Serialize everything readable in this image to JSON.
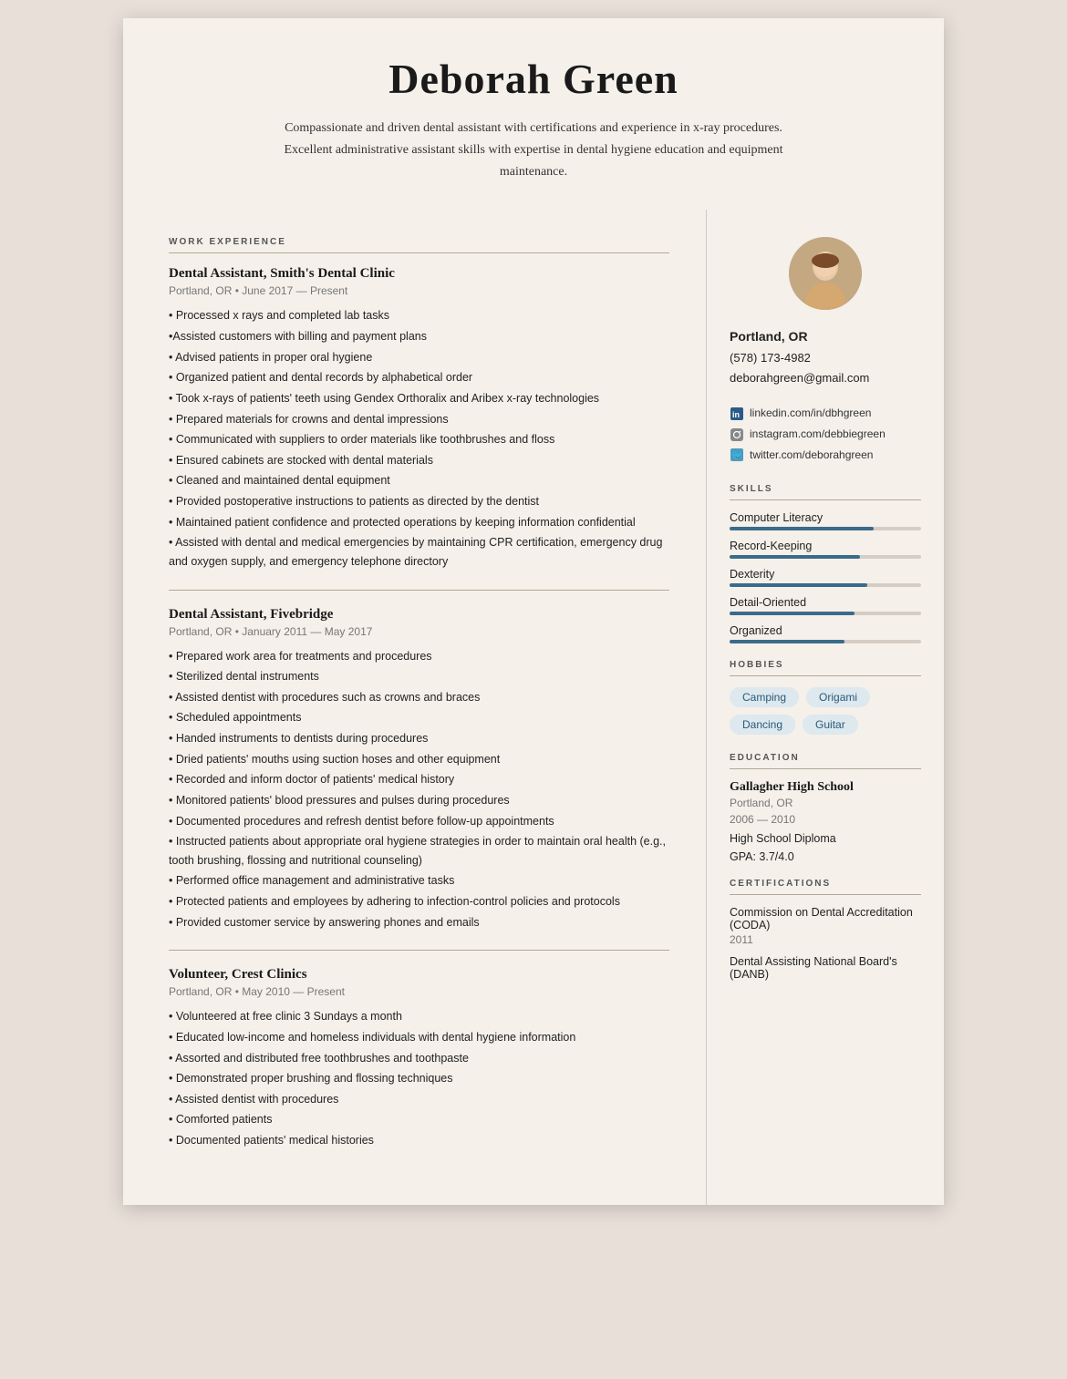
{
  "header": {
    "name": "Deborah Green",
    "summary": "Compassionate and driven dental assistant with certifications and experience in x-ray procedures. Excellent administrative assistant skills with expertise in dental hygiene education and equipment maintenance."
  },
  "sidebar": {
    "location": "Portland, OR",
    "phone": "(578) 173-4982",
    "email": "deborahgreen@gmail.com",
    "social": [
      {
        "icon": "linkedin",
        "text": "linkedin.com/in/dbhgreen"
      },
      {
        "icon": "instagram",
        "text": "instagram.com/debbiegreen"
      },
      {
        "icon": "twitter",
        "text": "twitter.com/deborahgreen"
      }
    ],
    "skills_label": "SKILLS",
    "skills": [
      {
        "name": "Computer Literacy",
        "pct": 75
      },
      {
        "name": "Record-Keeping",
        "pct": 68
      },
      {
        "name": "Dexterity",
        "pct": 72
      },
      {
        "name": "Detail-Oriented",
        "pct": 65
      },
      {
        "name": "Organized",
        "pct": 60
      }
    ],
    "hobbies_label": "HOBBIES",
    "hobbies": [
      "Camping",
      "Origami",
      "Dancing",
      "Guitar"
    ],
    "education_label": "EDUCATION",
    "education": [
      {
        "school": "Gallagher High School",
        "location": "Portland, OR",
        "years": "2006 — 2010",
        "degree": "High School Diploma",
        "gpa": "GPA: 3.7/4.0"
      }
    ],
    "certifications_label": "CERTIFICATIONS",
    "certifications": [
      {
        "name": "Commission on Dental Accreditation (CODA)",
        "year": "2011"
      },
      {
        "name": "Dental Assisting National Board's (DANB)",
        "year": ""
      }
    ]
  },
  "main": {
    "work_experience_label": "WORK EXPERIENCE",
    "jobs": [
      {
        "title": "Dental Assistant, Smith's Dental Clinic",
        "meta": "Portland, OR • June 2017 — Present",
        "bullets": [
          "• Processed x rays and completed lab tasks",
          "•Assisted customers with billing and payment plans",
          "• Advised patients in proper oral hygiene",
          "• Organized patient and dental records by alphabetical order",
          "• Took x-rays of patients' teeth using Gendex Orthoralix and Aribex x-ray technologies",
          "• Prepared materials for crowns and dental impressions",
          "• Communicated with suppliers to order materials like toothbrushes and floss",
          "• Ensured cabinets are stocked with dental materials",
          "• Cleaned and maintained dental equipment",
          "• Provided postoperative instructions to patients as directed by the dentist",
          "• Maintained patient confidence and protected operations by keeping information confidential",
          "• Assisted with dental and medical emergencies by maintaining CPR certification, emergency drug and oxygen supply, and emergency telephone directory"
        ]
      },
      {
        "title": "Dental Assistant, Fivebridge",
        "meta": "Portland, OR • January 2011 — May 2017",
        "bullets": [
          "• Prepared work area for treatments and procedures",
          "• Sterilized dental instruments",
          "• Assisted dentist with procedures such as crowns and braces",
          "• Scheduled appointments",
          "• Handed instruments to dentists during procedures",
          "• Dried patients' mouths using suction hoses and other equipment",
          "• Recorded and inform doctor of patients' medical history",
          "• Monitored patients' blood pressures and pulses during procedures",
          "• Documented procedures and refresh dentist before follow-up appointments",
          "• Instructed patients about appropriate oral hygiene strategies in order to maintain oral health (e.g., tooth brushing, flossing and nutritional counseling)",
          "• Performed office management and administrative tasks",
          "• Protected patients and employees by adhering to infection-control policies and protocols",
          "• Provided customer service by answering phones and emails"
        ]
      },
      {
        "title": "Volunteer, Crest Clinics",
        "meta": "Portland, OR • May 2010 — Present",
        "bullets": [
          "• Volunteered at free clinic 3 Sundays a month",
          "• Educated low-income and homeless individuals with dental hygiene information",
          "• Assorted and distributed free toothbrushes and toothpaste",
          "• Demonstrated proper brushing and flossing techniques",
          "• Assisted dentist with procedures",
          "• Comforted patients",
          "• Documented patients' medical histories"
        ]
      }
    ]
  }
}
